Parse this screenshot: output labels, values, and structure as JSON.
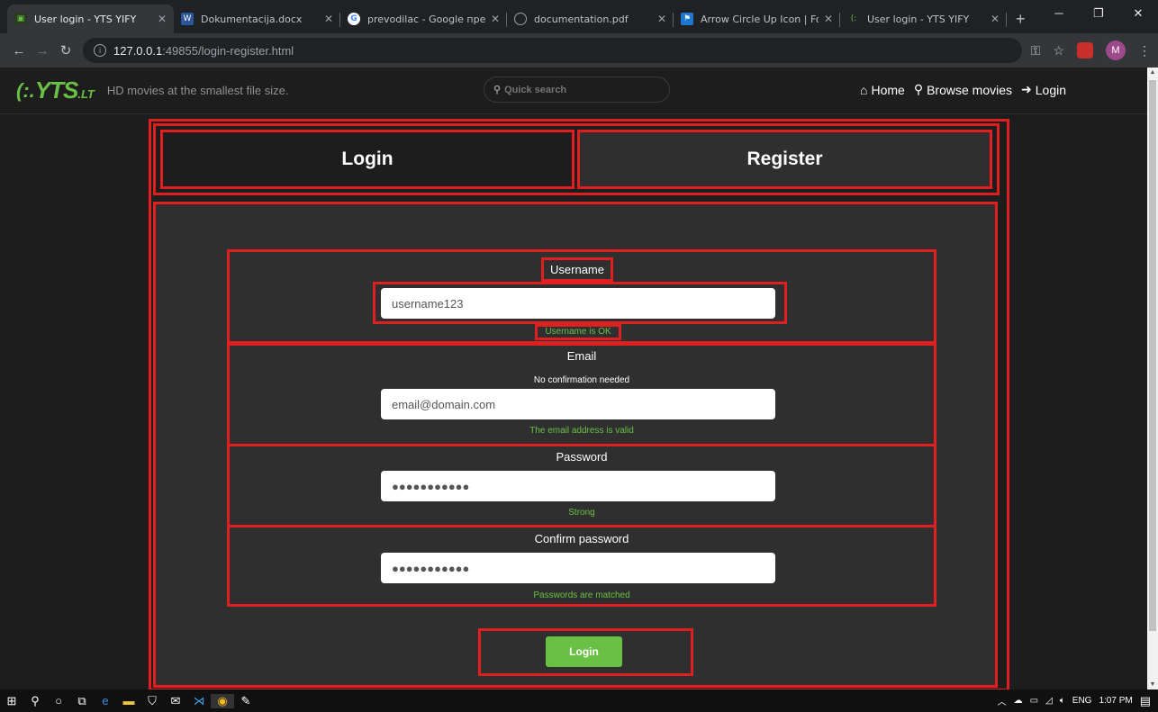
{
  "browser": {
    "tabs": [
      {
        "title": "User login - YTS YIFY",
        "icon": "yts-favicon",
        "active": true
      },
      {
        "title": "Dokumentacija.docx",
        "icon": "word-favicon",
        "active": false
      },
      {
        "title": "prevodilac - Google претра",
        "icon": "google-favicon",
        "active": false
      },
      {
        "title": "documentation.pdf",
        "icon": "pdf-favicon",
        "active": false
      },
      {
        "title": "Arrow Circle Up Icon | Font A",
        "icon": "fontawesome-favicon",
        "active": false
      },
      {
        "title": "User login - YTS YIFY",
        "icon": "yts-favicon",
        "active": false
      }
    ],
    "new_tab": "+",
    "address": {
      "host": "127.0.0.1",
      "rest": ":49855/login-register.html"
    },
    "profile_initial": "M"
  },
  "site": {
    "logo": {
      "mark": "(:.",
      "name": "YTS",
      "suffix": ".LT"
    },
    "tagline": "HD movies at the smallest file size.",
    "search_placeholder": "Quick search",
    "nav": {
      "home": "Home",
      "browse": "Browse movies",
      "login": "Login"
    }
  },
  "auth": {
    "tab_login": "Login",
    "tab_register": "Register",
    "username": {
      "label": "Username",
      "value": "username123",
      "status": "Username is OK"
    },
    "email": {
      "label": "Email",
      "note": "No confirmation needed",
      "value": "email@domain.com",
      "status": "The email address is valid"
    },
    "password": {
      "label": "Password",
      "value": "●●●●●●●●●●●",
      "status": "Strong"
    },
    "confirm": {
      "label": "Confirm password",
      "value": "●●●●●●●●●●●",
      "status": "Passwords are matched"
    },
    "submit_label": "Login"
  },
  "taskbar": {
    "lang": "ENG",
    "time": "1:07 PM"
  },
  "colors": {
    "accent": "#6ac045",
    "highlight": "#e02020",
    "background": "#1d1d1d",
    "panel": "#2f2f2f"
  }
}
